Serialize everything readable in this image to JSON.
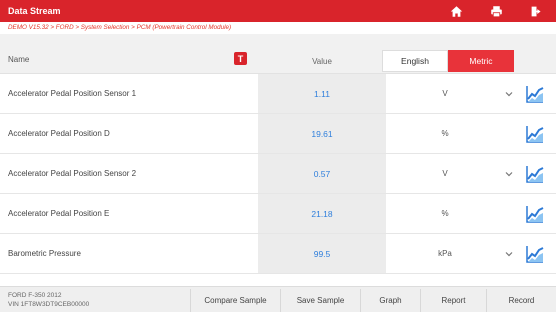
{
  "window": {
    "title": "Data Stream",
    "accent": "#d9242b"
  },
  "toolbar": {
    "icons": [
      "home-icon",
      "print-icon",
      "exit-icon"
    ]
  },
  "breadcrumb": "DEMO V15.32 > FORD > System Selection > PCM (Powertrain Control Module)",
  "header": {
    "name_label": "Name",
    "sort_icon_letter": "T",
    "value_label": "Value",
    "english_label": "English",
    "metric_label": "Metric",
    "active_units": "Metric"
  },
  "rows": [
    {
      "name": "Accelerator Pedal Position Sensor 1",
      "value": "1.11",
      "unit": "V",
      "has_dropdown": true
    },
    {
      "name": "Accelerator Pedal Position D",
      "value": "19.61",
      "unit": "%",
      "has_dropdown": false
    },
    {
      "name": "Accelerator Pedal Position Sensor 2",
      "value": "0.57",
      "unit": "V",
      "has_dropdown": true
    },
    {
      "name": "Accelerator Pedal Position E",
      "value": "21.18",
      "unit": "%",
      "has_dropdown": false
    },
    {
      "name": "Barometric Pressure",
      "value": "99.5",
      "unit": "kPa",
      "has_dropdown": true
    }
  ],
  "footer": {
    "vehicle_line1": "FORD F-350 2012",
    "vehicle_line2": "VIN 1FT8W3DT9CEB00000",
    "buttons": {
      "compare_sample": "Compare Sample",
      "save_sample": "Save Sample",
      "graph": "Graph",
      "report": "Report",
      "record": "Record"
    }
  }
}
